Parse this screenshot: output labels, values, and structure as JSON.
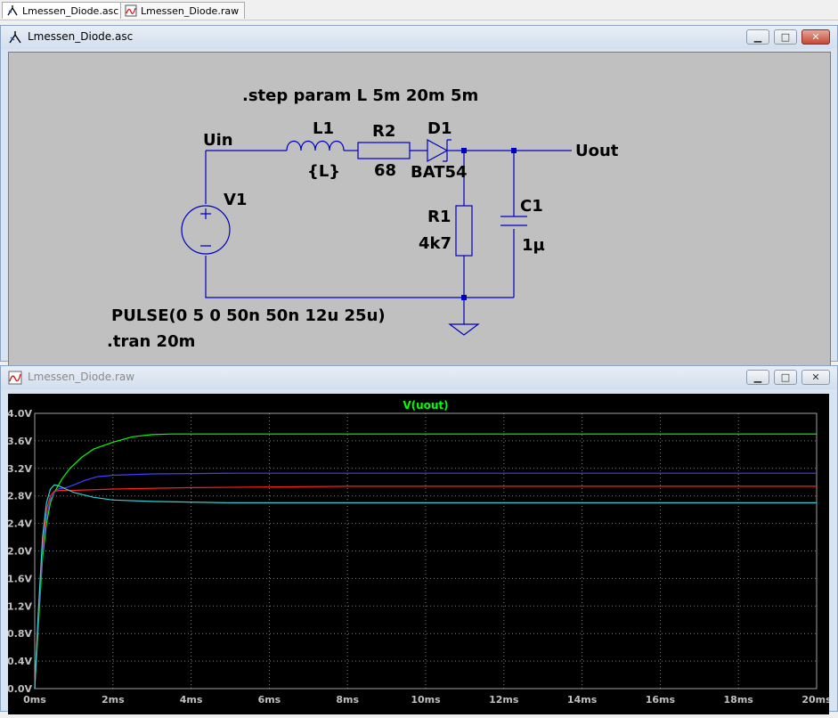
{
  "tabs": [
    {
      "label": "Lmessen_Diode.asc",
      "icon": "schematic-icon",
      "active": true
    },
    {
      "label": "Lmessen_Diode.raw",
      "icon": "waveform-icon",
      "active": false
    }
  ],
  "schematic_window": {
    "title": "Lmessen_Diode.asc",
    "buttons": {
      "minimize": "▁",
      "maximize": "□",
      "close": "✕"
    },
    "directives": {
      "step": ".step param L 5m 20m 5m",
      "source": "PULSE(0 5 0 50n 50n 12u 25u)",
      "tran": ".tran 20m"
    },
    "nets": {
      "input": "Uin",
      "output": "Uout"
    },
    "components": {
      "V1": {
        "name": "V1"
      },
      "L1": {
        "name": "L1",
        "value": "{L}"
      },
      "R2": {
        "name": "R2",
        "value": "68"
      },
      "D1": {
        "name": "D1",
        "value": "BAT54"
      },
      "R1": {
        "name": "R1",
        "value": "4k7"
      },
      "C1": {
        "name": "C1",
        "value": "1µ"
      }
    },
    "colors": {
      "wire": "#0000c0",
      "background": "#c0c0c0",
      "text": "#000000"
    }
  },
  "plot_window": {
    "title": "Lmessen_Diode.raw",
    "buttons": {
      "minimize": "▁",
      "maximize": "□",
      "close": "✕"
    }
  },
  "chart_data": {
    "type": "line",
    "title": "V(uout)",
    "xlabel": "",
    "ylabel": "",
    "xlim": [
      0,
      20
    ],
    "ylim": [
      0,
      4.0
    ],
    "x_ticks": [
      "0ms",
      "2ms",
      "4ms",
      "6ms",
      "8ms",
      "10ms",
      "12ms",
      "14ms",
      "16ms",
      "18ms",
      "20ms"
    ],
    "y_ticks": [
      "0.0V",
      "0.4V",
      "0.8V",
      "1.2V",
      "1.6V",
      "2.0V",
      "2.4V",
      "2.8V",
      "3.2V",
      "3.6V",
      "4.0V"
    ],
    "grid": true,
    "title_color": "#00ff00",
    "series": [
      {
        "color": "#00ff00",
        "x": [
          0,
          0.1,
          0.2,
          0.3,
          0.4,
          0.5,
          0.7,
          0.9,
          1.2,
          1.5,
          2.0,
          2.5,
          3.0,
          3.5,
          5,
          10,
          20
        ],
        "y": [
          0,
          1.0,
          1.9,
          2.4,
          2.7,
          2.85,
          3.05,
          3.2,
          3.36,
          3.48,
          3.58,
          3.66,
          3.69,
          3.7,
          3.7,
          3.7,
          3.7
        ]
      },
      {
        "color": "#4040ff",
        "x": [
          0,
          0.1,
          0.2,
          0.3,
          0.4,
          0.5,
          0.6,
          0.8,
          1.0,
          1.3,
          1.6,
          2.0,
          3,
          5,
          10,
          20
        ],
        "y": [
          0,
          1.1,
          2.0,
          2.5,
          2.75,
          2.85,
          2.9,
          2.92,
          2.96,
          3.03,
          3.08,
          3.1,
          3.12,
          3.13,
          3.13,
          3.13
        ]
      },
      {
        "color": "#ff2020",
        "x": [
          0,
          0.1,
          0.2,
          0.3,
          0.4,
          0.5,
          0.7,
          1.0,
          2,
          4,
          8,
          20
        ],
        "y": [
          0,
          1.2,
          2.1,
          2.6,
          2.8,
          2.87,
          2.88,
          2.88,
          2.9,
          2.92,
          2.94,
          2.94
        ]
      },
      {
        "color": "#30d0d0",
        "x": [
          0,
          0.1,
          0.2,
          0.3,
          0.4,
          0.5,
          0.6,
          0.8,
          1.0,
          1.5,
          2.0,
          3,
          5,
          10,
          20
        ],
        "y": [
          0,
          1.2,
          2.2,
          2.7,
          2.9,
          2.96,
          2.95,
          2.9,
          2.85,
          2.78,
          2.74,
          2.72,
          2.7,
          2.7,
          2.7
        ]
      }
    ]
  }
}
